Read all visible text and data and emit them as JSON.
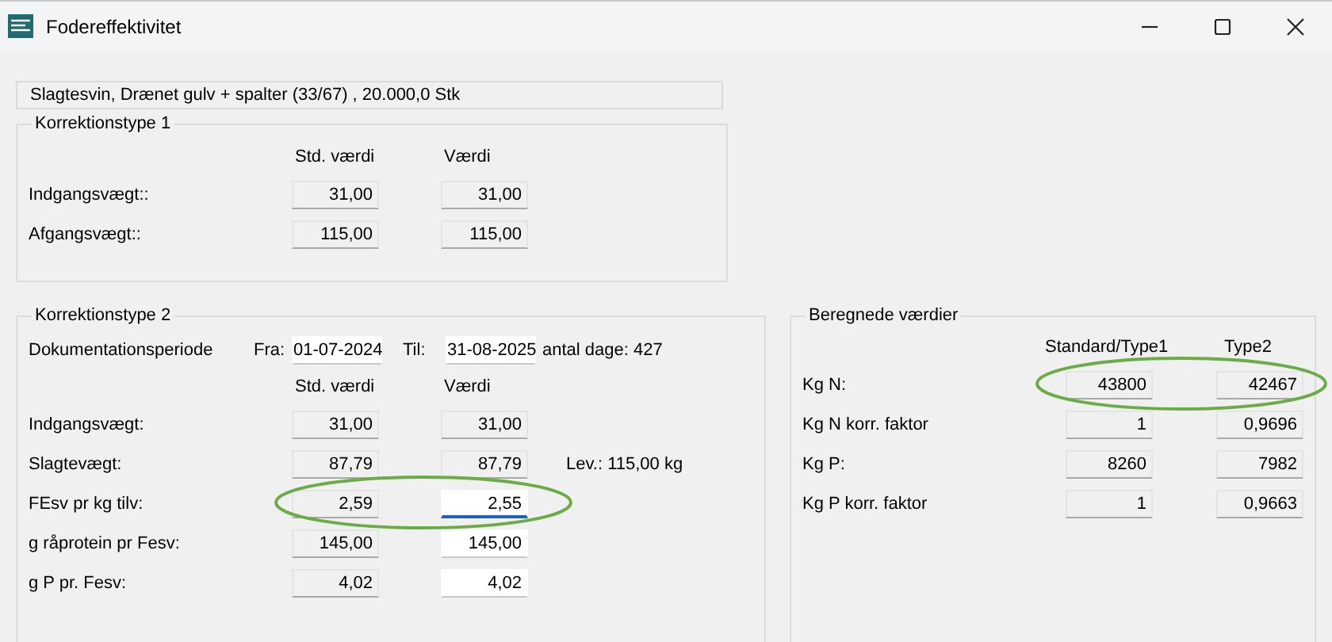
{
  "window": {
    "title": "Fodereffektivitet"
  },
  "summary": "Slagtesvin, Drænet gulv + spalter (33/67) , 20.000,0 Stk",
  "group1": {
    "title": "Korrektionstype 1",
    "headers": [
      "Std. værdi",
      "Værdi"
    ],
    "rows": [
      {
        "label": "Indgangsvægt::",
        "values": [
          {
            "text": "31,00",
            "editable": false
          },
          {
            "text": "31,00",
            "editable": false
          }
        ]
      },
      {
        "label": "Afgangsvægt::",
        "values": [
          {
            "text": "115,00",
            "editable": false
          },
          {
            "text": "115,00",
            "editable": false
          }
        ]
      }
    ]
  },
  "group2": {
    "title": "Korrektionstype 2",
    "period": {
      "label": "Dokumentationsperiode",
      "from_label": "Fra:",
      "from": "01-07-2024",
      "to_label": "Til:",
      "to": "31-08-2025",
      "days": "antal dage: 427"
    },
    "headers": [
      "Std. værdi",
      "Værdi"
    ],
    "rows": [
      {
        "label": "Indgangsvægt:",
        "circled": false,
        "values": [
          {
            "text": "31,00",
            "editable": false,
            "focused": false
          },
          {
            "text": "31,00",
            "editable": false,
            "focused": false
          }
        ]
      },
      {
        "label": "Slagtevægt:",
        "circled": false,
        "note": "Lev.: 115,00 kg",
        "values": [
          {
            "text": "87,79",
            "editable": false,
            "focused": false
          },
          {
            "text": "87,79",
            "editable": false,
            "focused": false
          }
        ]
      },
      {
        "label": "FEsv pr kg tilv:",
        "circled": true,
        "values": [
          {
            "text": "2,59",
            "editable": false,
            "focused": false
          },
          {
            "text": "2,55",
            "editable": true,
            "focused": true
          }
        ]
      },
      {
        "label": "g råprotein pr Fesv:",
        "circled": false,
        "values": [
          {
            "text": "145,00",
            "editable": false,
            "focused": false
          },
          {
            "text": "145,00",
            "editable": true,
            "focused": false
          }
        ]
      },
      {
        "label": "g P pr. Fesv:",
        "circled": false,
        "values": [
          {
            "text": "4,02",
            "editable": false,
            "focused": false
          },
          {
            "text": "4,02",
            "editable": true,
            "focused": false
          }
        ]
      }
    ]
  },
  "group3": {
    "title": "Beregnede værdier",
    "headers": [
      "Standard/Type1",
      "Type2"
    ],
    "rows": [
      {
        "label": "Kg N:",
        "circled": true,
        "values": [
          "43800",
          "42467"
        ]
      },
      {
        "label": "Kg N korr. faktor",
        "circled": false,
        "values": [
          "1",
          "0,9696"
        ]
      },
      {
        "label": "Kg P:",
        "circled": false,
        "values": [
          "8260",
          "7982"
        ]
      },
      {
        "label": "Kg P korr. faktor",
        "circled": false,
        "values": [
          "1",
          "0,9663"
        ]
      }
    ]
  }
}
